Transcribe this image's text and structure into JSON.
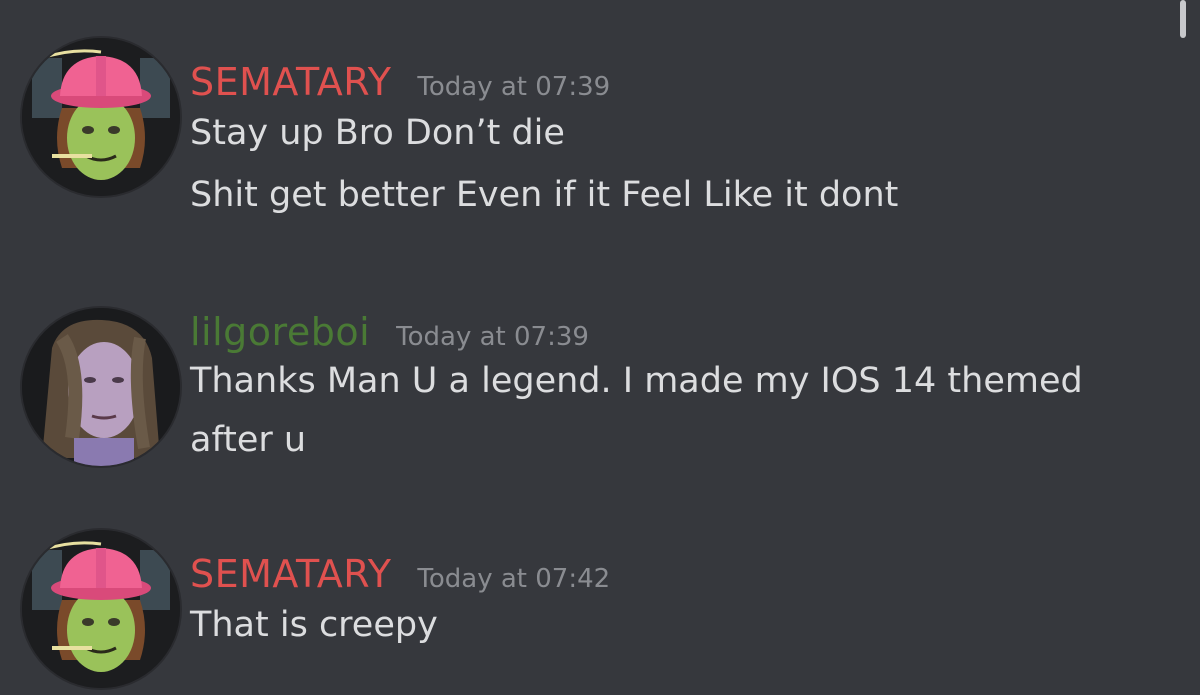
{
  "colors": {
    "background": "#36383d",
    "sematary_name": "#e0514f",
    "lilgoreboi_name": "#4a7a35",
    "message_text": "#dcdddf",
    "timestamp": "#8a8c91"
  },
  "messages": [
    {
      "username": "SEMATARY",
      "timestamp": "Today at 07:39",
      "avatar_icon": "pink-hardhat-character-avatar",
      "lines": [
        "Stay up Bro Don’t die",
        "Shit get better Even if it Feel Like it dont"
      ]
    },
    {
      "username": "lilgoreboi",
      "timestamp": "Today at 07:39",
      "avatar_icon": "long-hair-pale-face-avatar",
      "lines": [
        "Thanks Man U a legend. I made my IOS 14 themed",
        "after u"
      ]
    },
    {
      "username": "SEMATARY",
      "timestamp": "Today at 07:42",
      "avatar_icon": "pink-hardhat-character-avatar",
      "lines": [
        "That is creepy"
      ]
    }
  ]
}
